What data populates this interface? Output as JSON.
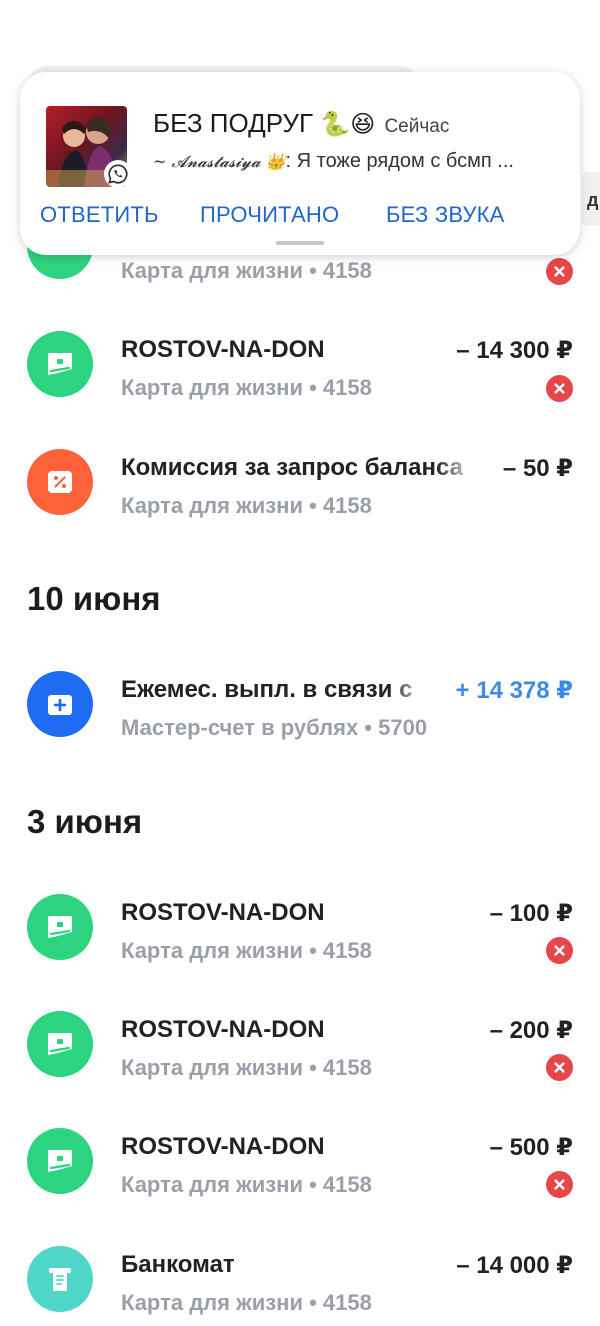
{
  "notification": {
    "group_name": "БЕЗ ПОДРУГ",
    "group_emojis": "🐍😆",
    "time": "Сейчас",
    "sender": "~ 𝓐𝓷𝓪𝓼𝓽𝓪𝓼𝓲𝔂𝓪 👑",
    "message": ": Я тоже рядом с бсмп ...",
    "actions": {
      "reply": "ОТВЕТИТЬ",
      "mark_read": "ПРОЧИТАНО",
      "mute": "БЕЗ ЗВУКА"
    },
    "app_icon": "whatsapp-icon",
    "edge_tab_text": "д"
  },
  "sections": [
    {
      "date": "",
      "transactions": [
        {
          "title": "",
          "subtitle": "Карта для жизни • 4158",
          "amount": "",
          "icon": "card-icon",
          "icon_color": "#2dd47f",
          "declined": true
        }
      ]
    },
    {
      "date": "",
      "transactions": [
        {
          "title": "ROSTOV-NA-DON",
          "subtitle": "Карта для жизни • 4158",
          "amount": "– 14 300 ₽",
          "icon": "card-icon",
          "icon_color": "#2dd47f",
          "declined": true
        },
        {
          "title": "Комиссия за запрос баланса",
          "subtitle": "Карта для жизни • 4158",
          "amount": "– 50 ₽",
          "icon": "percent-icon",
          "icon_color": "#fe6238",
          "declined": false
        }
      ]
    },
    {
      "date": "10 июня",
      "transactions": [
        {
          "title": "Ежемес. выпл. в связи с",
          "subtitle": "Мастер-счет в рублях • 5700",
          "amount": "+ 14 378 ₽",
          "icon": "plus-icon",
          "icon_color": "#1f6cf2",
          "declined": false
        }
      ]
    },
    {
      "date": "3 июня",
      "transactions": [
        {
          "title": "ROSTOV-NA-DON",
          "subtitle": "Карта для жизни • 4158",
          "amount": "– 100 ₽",
          "icon": "card-icon",
          "icon_color": "#2dd47f",
          "declined": true
        },
        {
          "title": "ROSTOV-NA-DON",
          "subtitle": "Карта для жизни • 4158",
          "amount": "– 200 ₽",
          "icon": "card-icon",
          "icon_color": "#2dd47f",
          "declined": true
        },
        {
          "title": "ROSTOV-NA-DON",
          "subtitle": "Карта для жизни • 4158",
          "amount": "– 500 ₽",
          "icon": "card-icon",
          "icon_color": "#2dd47f",
          "declined": true
        },
        {
          "title": "Банкомат",
          "subtitle": "Карта для жизни • 4158",
          "amount": "– 14 000 ₽",
          "icon": "atm-icon",
          "icon_color": "#4fd6c8",
          "declined": false
        }
      ]
    }
  ]
}
